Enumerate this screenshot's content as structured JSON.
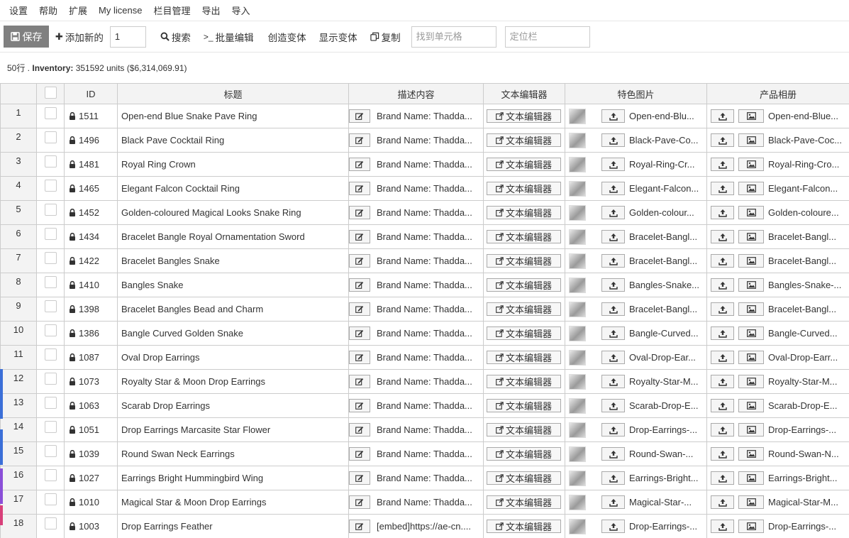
{
  "menu": {
    "items": [
      "设置",
      "帮助",
      "扩展",
      "My license",
      "栏目管理",
      "导出",
      "导入"
    ]
  },
  "toolbar": {
    "save_label": "保存",
    "add_new_label": "添加新的",
    "add_count_value": "1",
    "search_label": "搜索",
    "bulk_edit_label": "批量编辑",
    "create_variation_label": "创造变体",
    "show_variations_label": "显示变体",
    "copy_label": "复制",
    "find_cell_placeholder": "找到单元格",
    "locate_column_placeholder": "定位栏"
  },
  "summary": {
    "rows_text": "50行 . ",
    "inventory_label": "Inventory:",
    "inventory_value": " 351592 units ($6,314,069.91)"
  },
  "columns": {
    "id": "ID",
    "title": "标题",
    "description": "描述内容",
    "text_editor": "文本编辑器",
    "featured_image": "特色图片",
    "product_gallery": "产品相册"
  },
  "text_editor_label": "文本编辑器",
  "rows": [
    {
      "n": "1",
      "id": "1511",
      "title": "Open-end Blue Snake Pave Ring",
      "desc": "Brand Name: Thadda...",
      "feat": "Open-end-Blu...",
      "gal": "Open-end-Blue..."
    },
    {
      "n": "2",
      "id": "1496",
      "title": "Black Pave Cocktail Ring",
      "desc": "Brand Name: Thadda...",
      "feat": "Black-Pave-Co...",
      "gal": "Black-Pave-Coc..."
    },
    {
      "n": "3",
      "id": "1481",
      "title": "Royal Ring Crown",
      "desc": "Brand Name: Thadda...",
      "feat": "Royal-Ring-Cr...",
      "gal": "Royal-Ring-Cro..."
    },
    {
      "n": "4",
      "id": "1465",
      "title": "Elegant Falcon Cocktail Ring",
      "desc": "Brand Name: Thadda...",
      "feat": "Elegant-Falcon...",
      "gal": "Elegant-Falcon..."
    },
    {
      "n": "5",
      "id": "1452",
      "title": "Golden-coloured Magical Looks Snake Ring",
      "desc": "Brand Name: Thadda...",
      "feat": "Golden-colour...",
      "gal": "Golden-coloure..."
    },
    {
      "n": "6",
      "id": "1434",
      "title": "Bracelet Bangle Royal Ornamentation Sword",
      "desc": "Brand Name: Thadda...",
      "feat": "Bracelet-Bangl...",
      "gal": "Bracelet-Bangl..."
    },
    {
      "n": "7",
      "id": "1422",
      "title": "Bracelet Bangles Snake",
      "desc": "Brand Name: Thadda...",
      "feat": "Bracelet-Bangl...",
      "gal": "Bracelet-Bangl..."
    },
    {
      "n": "8",
      "id": "1410",
      "title": "Bangles Snake",
      "desc": "Brand Name: Thadda...",
      "feat": "Bangles-Snake...",
      "gal": "Bangles-Snake-..."
    },
    {
      "n": "9",
      "id": "1398",
      "title": "Bracelet Bangles Bead and Charm",
      "desc": "Brand Name: Thadda...",
      "feat": "Bracelet-Bangl...",
      "gal": "Bracelet-Bangl..."
    },
    {
      "n": "10",
      "id": "1386",
      "title": "Bangle Curved Golden Snake",
      "desc": "Brand Name: Thadda...",
      "feat": "Bangle-Curved...",
      "gal": "Bangle-Curved..."
    },
    {
      "n": "11",
      "id": "1087",
      "title": "Oval Drop Earrings",
      "desc": "Brand Name: Thadda...",
      "feat": "Oval-Drop-Ear...",
      "gal": "Oval-Drop-Earr..."
    },
    {
      "n": "12",
      "id": "1073",
      "title": "Royalty Star & Moon Drop Earrings",
      "desc": "Brand Name: Thadda...",
      "feat": "Royalty-Star-M...",
      "gal": "Royalty-Star-M..."
    },
    {
      "n": "13",
      "id": "1063",
      "title": "Scarab Drop Earrings",
      "desc": "Brand Name: Thadda...",
      "feat": "Scarab-Drop-E...",
      "gal": "Scarab-Drop-E..."
    },
    {
      "n": "14",
      "id": "1051",
      "title": "Drop Earrings Marcasite Star Flower",
      "desc": "Brand Name: Thadda...",
      "feat": "Drop-Earrings-...",
      "gal": "Drop-Earrings-..."
    },
    {
      "n": "15",
      "id": "1039",
      "title": "Round Swan Neck Earrings",
      "desc": "Brand Name: Thadda...",
      "feat": "Round-Swan-...",
      "gal": "Round-Swan-N..."
    },
    {
      "n": "16",
      "id": "1027",
      "title": "Earrings Bright Hummingbird Wing",
      "desc": "Brand Name: Thadda...",
      "feat": "Earrings-Bright...",
      "gal": "Earrings-Bright..."
    },
    {
      "n": "17",
      "id": "1010",
      "title": "Magical Star & Moon Drop Earrings",
      "desc": "Brand Name: Thadda...",
      "feat": "Magical-Star-...",
      "gal": "Magical-Star-M..."
    },
    {
      "n": "18",
      "id": "1003",
      "title": "Drop Earrings Feather",
      "desc": "[embed]https://ae-cn....",
      "feat": "Drop-Earrings-...",
      "gal": "Drop-Earrings-..."
    }
  ],
  "colors": {
    "save_button_bg": "#808080",
    "header_bg": "#f3f3f3",
    "grid_border": "#cccccc"
  }
}
